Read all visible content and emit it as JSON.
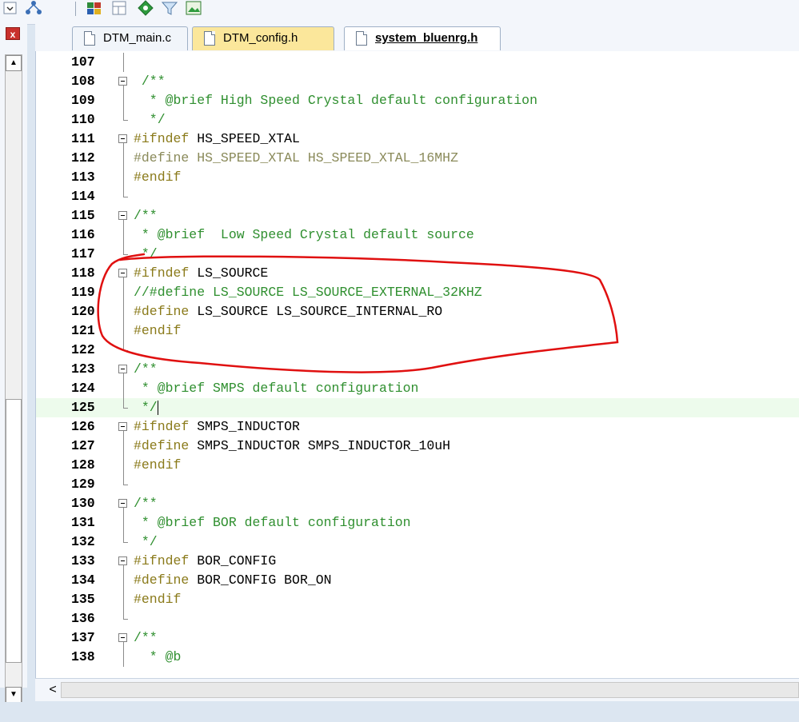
{
  "toolbar": {
    "icons": [
      "dropdown-icon",
      "network-icon",
      "grid-icon",
      "layout-icon",
      "diamond-icon",
      "filter-icon",
      "image-icon"
    ]
  },
  "tabs": [
    {
      "label": "DTM_main.c",
      "active": false
    },
    {
      "label": "DTM_config.h",
      "active": false
    },
    {
      "label": "system_bluenrg.h",
      "active": true
    }
  ],
  "editor": {
    "lines": [
      {
        "num": "107",
        "fold": "line",
        "tokens": []
      },
      {
        "num": "108",
        "fold": "box",
        "tokens": [
          {
            "t": " /**",
            "c": "comm"
          }
        ]
      },
      {
        "num": "109",
        "fold": "line",
        "tokens": [
          {
            "t": "  * @brief High Speed Crystal default configuration",
            "c": "comm"
          }
        ]
      },
      {
        "num": "110",
        "fold": "end",
        "tokens": [
          {
            "t": "  */",
            "c": "comm"
          }
        ]
      },
      {
        "num": "111",
        "fold": "box",
        "tokens": [
          {
            "t": "#ifndef ",
            "c": "dir"
          },
          {
            "t": "HS_SPEED_XTAL",
            "c": ""
          }
        ]
      },
      {
        "num": "112",
        "fold": "line",
        "tokens": [
          {
            "t": "#define HS_SPEED_XTAL HS_SPEED_XTAL_16MHZ",
            "c": "dim"
          }
        ]
      },
      {
        "num": "113",
        "fold": "line",
        "tokens": [
          {
            "t": "#endif",
            "c": "dir"
          }
        ]
      },
      {
        "num": "114",
        "fold": "end",
        "tokens": []
      },
      {
        "num": "115",
        "fold": "box",
        "tokens": [
          {
            "t": "/**",
            "c": "comm"
          }
        ]
      },
      {
        "num": "116",
        "fold": "line",
        "tokens": [
          {
            "t": " * @brief  Low Speed Crystal default source",
            "c": "comm"
          }
        ]
      },
      {
        "num": "117",
        "fold": "end",
        "tokens": [
          {
            "t": " */",
            "c": "comm"
          }
        ]
      },
      {
        "num": "118",
        "fold": "box",
        "tokens": [
          {
            "t": "#ifndef ",
            "c": "dir"
          },
          {
            "t": "LS_SOURCE",
            "c": ""
          }
        ]
      },
      {
        "num": "119",
        "fold": "line",
        "tokens": [
          {
            "t": "//#define LS_SOURCE LS_SOURCE_EXTERNAL_32KHZ",
            "c": "comm"
          }
        ]
      },
      {
        "num": "120",
        "fold": "line",
        "tokens": [
          {
            "t": "#define ",
            "c": "dir"
          },
          {
            "t": "LS_SOURCE LS_SOURCE_INTERNAL_RO",
            "c": ""
          }
        ]
      },
      {
        "num": "121",
        "fold": "line",
        "tokens": [
          {
            "t": "#endif",
            "c": "dir"
          }
        ]
      },
      {
        "num": "122",
        "fold": "end",
        "tokens": []
      },
      {
        "num": "123",
        "fold": "box",
        "tokens": [
          {
            "t": "/**",
            "c": "comm"
          }
        ]
      },
      {
        "num": "124",
        "fold": "line",
        "tokens": [
          {
            "t": " * @brief SMPS default configuration",
            "c": "comm"
          }
        ]
      },
      {
        "num": "125",
        "fold": "end",
        "current": true,
        "tokens": [
          {
            "t": " */",
            "c": "comm"
          }
        ]
      },
      {
        "num": "126",
        "fold": "box",
        "tokens": [
          {
            "t": "#ifndef ",
            "c": "dir"
          },
          {
            "t": "SMPS_INDUCTOR",
            "c": ""
          }
        ]
      },
      {
        "num": "127",
        "fold": "line",
        "tokens": [
          {
            "t": "#define ",
            "c": "dir"
          },
          {
            "t": "SMPS_INDUCTOR SMPS_INDUCTOR_10uH",
            "c": ""
          }
        ]
      },
      {
        "num": "128",
        "fold": "line",
        "tokens": [
          {
            "t": "#endif",
            "c": "dir"
          }
        ]
      },
      {
        "num": "129",
        "fold": "end",
        "tokens": []
      },
      {
        "num": "130",
        "fold": "box",
        "tokens": [
          {
            "t": "/**",
            "c": "comm"
          }
        ]
      },
      {
        "num": "131",
        "fold": "line",
        "tokens": [
          {
            "t": " * @brief BOR default configuration",
            "c": "comm"
          }
        ]
      },
      {
        "num": "132",
        "fold": "end",
        "tokens": [
          {
            "t": " */",
            "c": "comm"
          }
        ]
      },
      {
        "num": "133",
        "fold": "box",
        "tokens": [
          {
            "t": "#ifndef ",
            "c": "dir"
          },
          {
            "t": "BOR_CONFIG",
            "c": ""
          }
        ]
      },
      {
        "num": "134",
        "fold": "line",
        "tokens": [
          {
            "t": "#define ",
            "c": "dir"
          },
          {
            "t": "BOR_CONFIG BOR_ON",
            "c": ""
          }
        ]
      },
      {
        "num": "135",
        "fold": "line",
        "tokens": [
          {
            "t": "#endif",
            "c": "dir"
          }
        ]
      },
      {
        "num": "136",
        "fold": "end",
        "tokens": []
      },
      {
        "num": "137",
        "fold": "box",
        "tokens": [
          {
            "t": "/**",
            "c": "comm"
          }
        ]
      },
      {
        "num": "138",
        "fold": "line",
        "tokens": [
          {
            "t": "  * @b",
            "c": "comm"
          }
        ]
      }
    ]
  },
  "colors": {
    "directive": "#8a7a1a",
    "comment": "#2f8f2f",
    "current_line": "#edfbec",
    "annotation": "#e01010"
  },
  "scrollbar": {
    "left_arrow": "<",
    "up_arrow": "▲",
    "down_arrow": "▼"
  }
}
